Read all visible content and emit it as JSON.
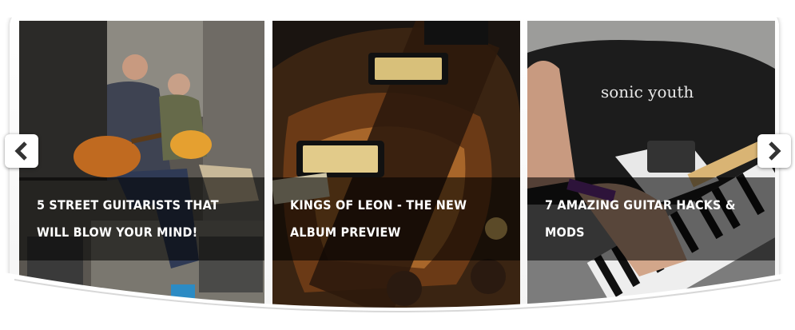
{
  "slider": {
    "slides": [
      {
        "caption": "5 STREET GUITARISTS THAT WILL BLOW YOUR MIND!"
      },
      {
        "caption": "KINGS OF LEON - THE NEW ALBUM PREVIEW"
      },
      {
        "caption": "7 AMAZING GUITAR HACKS & MODS",
        "shirt_text": "sonic youth"
      }
    ],
    "prev_icon": "chevron-left-icon",
    "next_icon": "chevron-right-icon"
  },
  "colors": {
    "caption_overlay": "#000000",
    "caption_text": "#ffffff",
    "arrow": "#333333"
  }
}
